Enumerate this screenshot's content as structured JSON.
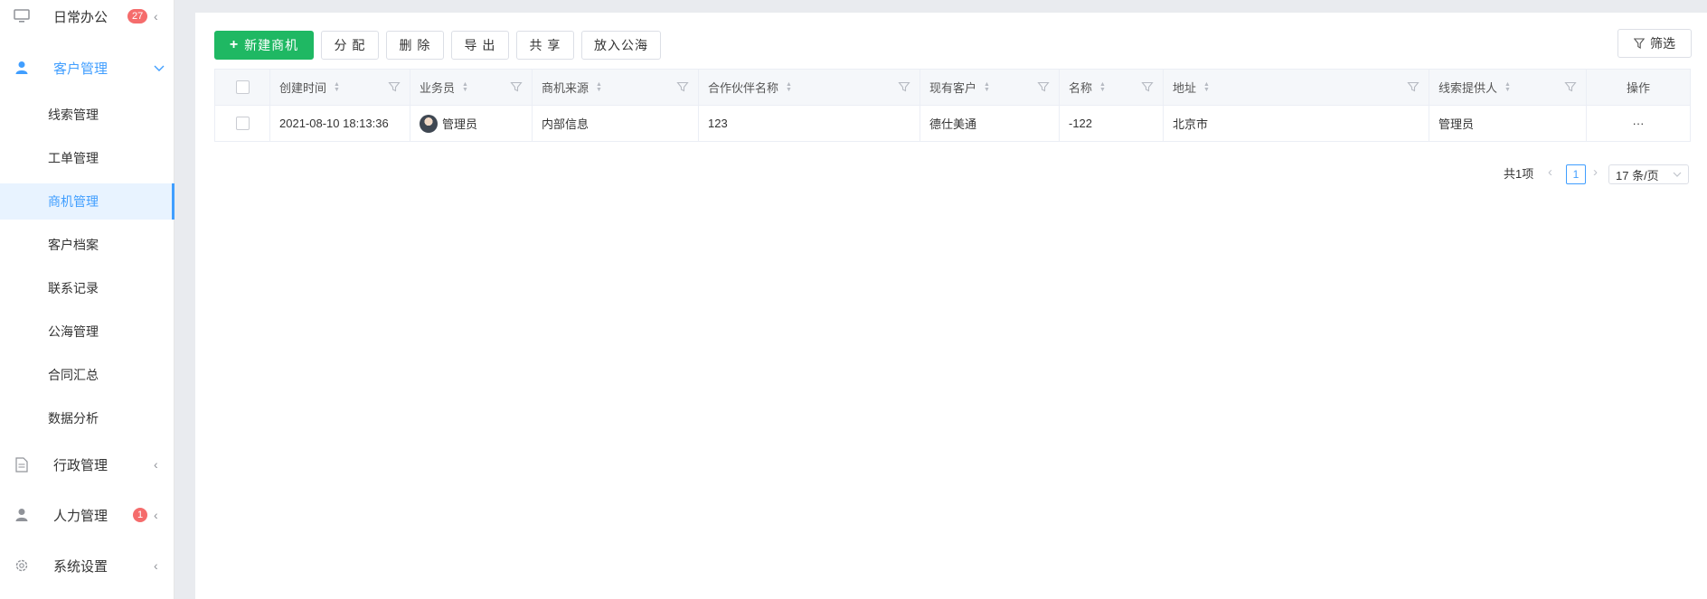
{
  "sidebar": {
    "groups": [
      {
        "label": "日常办公",
        "icon": "monitor-icon",
        "badge": "27"
      },
      {
        "label": "客户管理",
        "icon": "user-icon"
      },
      {
        "label": "行政管理",
        "icon": "document-icon"
      },
      {
        "label": "人力管理",
        "icon": "person-icon",
        "badge": "1"
      },
      {
        "label": "系统设置",
        "icon": "gear-icon"
      }
    ],
    "sub_items": [
      "线索管理",
      "工单管理",
      "商机管理",
      "客户档案",
      "联系记录",
      "公海管理",
      "合同汇总",
      "数据分析"
    ],
    "active_sub_item": "商机管理"
  },
  "toolbar": {
    "new_label": "新建商机",
    "assign_label": "分 配",
    "delete_label": "删 除",
    "export_label": "导 出",
    "share_label": "共 享",
    "to_pool_label": "放入公海",
    "filter_label": "筛选"
  },
  "table": {
    "columns": [
      "创建时间",
      "业务员",
      "商机来源",
      "合作伙伴名称",
      "现有客户",
      "名称",
      "地址",
      "线索提供人",
      "操作"
    ],
    "rows": [
      {
        "created": "2021-08-10 18:13:36",
        "salesperson": "管理员",
        "source": "内部信息",
        "partner": "123",
        "customer": "德仕美通",
        "name": "-122",
        "address": "北京市",
        "provider": "管理员",
        "actions": "···"
      }
    ]
  },
  "pagination": {
    "total": "共1项",
    "current_page": "1",
    "page_size": "17 条/页"
  },
  "colors": {
    "primary_green": "#1fb863",
    "accent_blue": "#409eff",
    "badge_red": "#f56c6c"
  }
}
